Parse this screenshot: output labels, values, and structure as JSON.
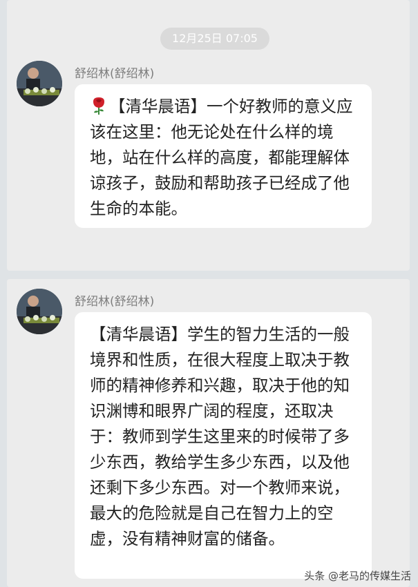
{
  "chat": {
    "timestamp": "12月25日 07:05",
    "messages": [
      {
        "sender": "舒绍林(舒绍林)",
        "icon": "rose-emoji",
        "text": "【清华晨语】一个好教师的意义应该在这里：他无论处在什么样的境地，站在什么样的高度，都能理解体谅孩子，鼓励和帮助孩子已经成了他生命的本能。"
      },
      {
        "sender": "舒绍林(舒绍林)",
        "text": "【清华晨语】学生的智力生活的一般境界和性质，在很大程度上取决于教师的精神修养和兴趣，取决于他的知识渊博和眼界广阔的程度，还取决于：教师到学生这里来的时候带了多少东西，教给学生多少东西，以及他还剩下多少东西。对一个教师来说，最大的危险就是自己在智力上的空虚，没有精神财富的储备。"
      }
    ]
  },
  "watermark": "头条 @老马的传媒生活",
  "colors": {
    "background": "#dfe3e6",
    "panel": "#ececec",
    "bubble": "#ffffff",
    "timestamp_pill": "#dadada"
  }
}
